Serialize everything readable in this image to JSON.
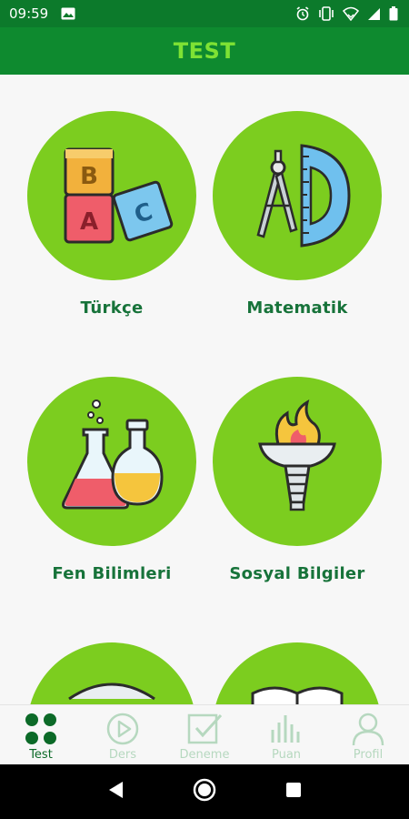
{
  "status_bar": {
    "time": "09:59",
    "icons": [
      "image-icon",
      "alarm-icon",
      "vibrate-icon",
      "wifi-icon",
      "signal-icon",
      "battery-icon"
    ]
  },
  "app_bar": {
    "title": "TEST"
  },
  "subjects": [
    {
      "label": "Türkçe",
      "icon": "abc-blocks-icon"
    },
    {
      "label": "Matematik",
      "icon": "compass-protractor-icon"
    },
    {
      "label": "Fen Bilimleri",
      "icon": "lab-flasks-icon"
    },
    {
      "label": "Sosyal Bilgiler",
      "icon": "torch-icon"
    },
    {
      "label": "",
      "icon": "subject-icon"
    },
    {
      "label": "",
      "icon": "book-icon"
    }
  ],
  "bottom_nav": [
    {
      "label": "Test",
      "icon": "grid-dots-icon",
      "active": true
    },
    {
      "label": "Ders",
      "icon": "play-circle-icon",
      "active": false
    },
    {
      "label": "Deneme",
      "icon": "checkbox-icon",
      "active": false
    },
    {
      "label": "Puan",
      "icon": "bar-chart-icon",
      "active": false
    },
    {
      "label": "Profil",
      "icon": "person-icon",
      "active": false
    }
  ],
  "system_nav": [
    "back-icon",
    "home-icon",
    "recents-icon"
  ],
  "colors": {
    "status_bar": "#0c7a2b",
    "app_bar": "#0e8a2f",
    "title": "#7ee234",
    "circle": "#7ccd1f",
    "label": "#17733a",
    "nav_active": "#0c6a28",
    "nav_inactive": "#b6d8bf"
  }
}
